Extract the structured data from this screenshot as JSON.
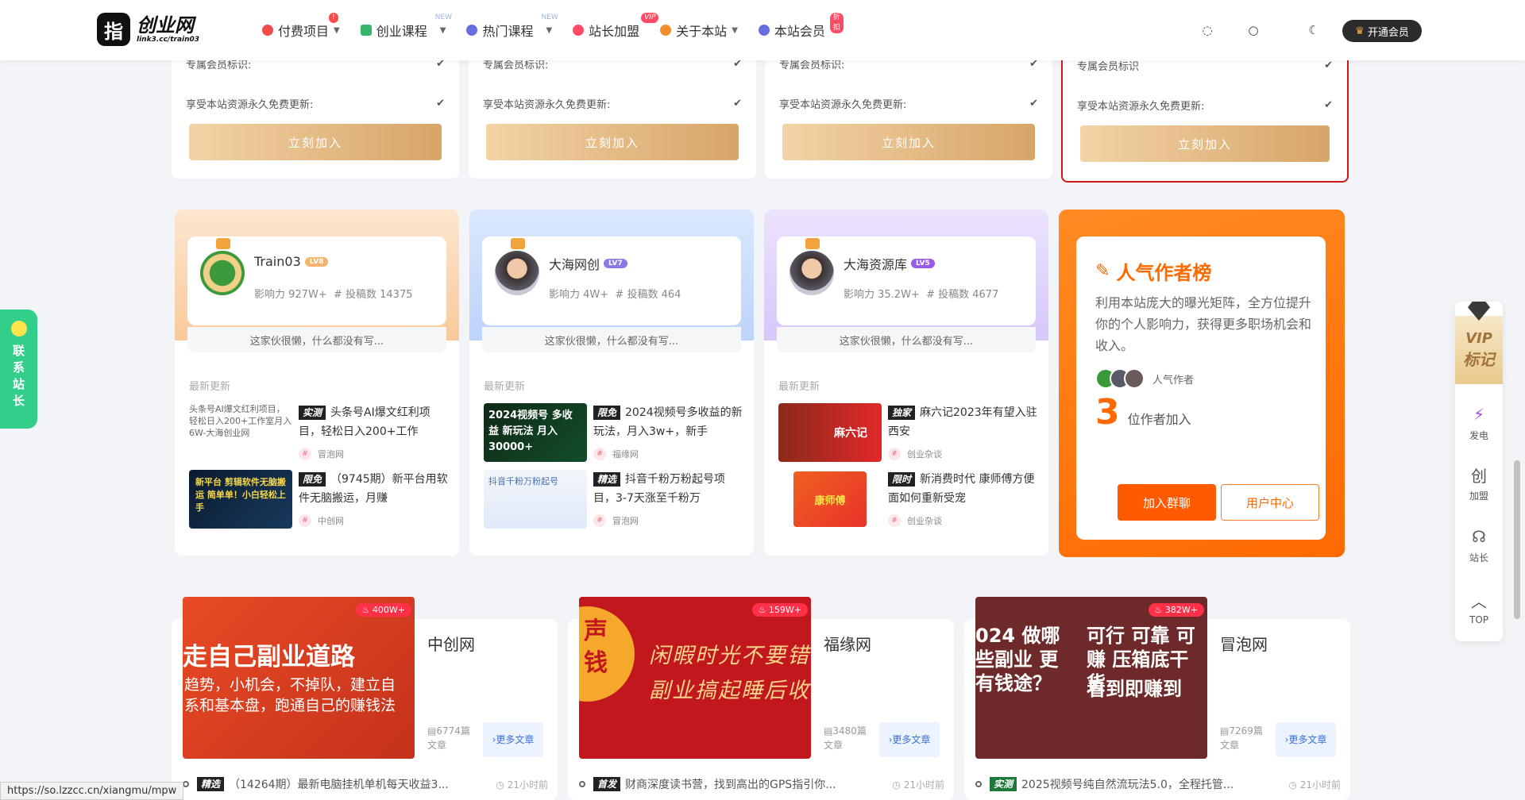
{
  "header": {
    "logo_mark": "指",
    "logo_name": "创业网",
    "logo_sub": "link3.cc/train03",
    "nav": [
      {
        "label": "付费项目",
        "badge": "",
        "icon_color": "#ef4b4b"
      },
      {
        "label": "创业课程",
        "badge": "NEW",
        "icon_color": "#35b56b"
      },
      {
        "label": "热门课程",
        "badge": "NEW",
        "icon_color": "#6a6fe0"
      },
      {
        "label": "站长加盟",
        "badge": "VIP",
        "icon_color": "#ff4b64"
      },
      {
        "label": "关于本站",
        "badge": "",
        "icon_color": "#f38c2a"
      },
      {
        "label": "本站会员",
        "badge": "折扣",
        "icon_color": "#6a6fe0"
      }
    ],
    "vip_button": "开通会员"
  },
  "plans": [
    {
      "row1": "专属会员标识:",
      "row2": "享受本站资源永久免费更新:",
      "button": "立刻加入"
    },
    {
      "row1": "专属会员标识:",
      "row2": "享受本站资源永久免费更新:",
      "button": "立刻加入"
    },
    {
      "row1": "专属会员标识:",
      "row2": "享受本站资源永久免费更新:",
      "button": "立刻加入"
    },
    {
      "row1": "专属会员标识",
      "row2": "享受本站资源永久免费更新:",
      "button": "立刻加入"
    }
  ],
  "authors": [
    {
      "name": "Train03",
      "level": "LV8",
      "influence": "影响力 927W+",
      "posts": "# 投稿数 14375",
      "bio": "这家伙很懒，什么都没有写...",
      "section": "最新更新",
      "items": [
        {
          "thumb_text": "头条号AI爆文红利项目，轻松日入200+工作室月入6W-大海创业网",
          "tag": "实测",
          "title": "头条号AI爆文红利项目，轻松日入200+工作",
          "src": "冒泡网"
        },
        {
          "thumb_text": "新平台 剪辑软件无脑搬运 简单单！小白轻松上手",
          "tag": "限免",
          "title": "（9745期）新平台用软件无脑搬运，月赚",
          "src": "中创网"
        }
      ]
    },
    {
      "name": "大海网创",
      "level": "LV7",
      "influence": "影响力 4W+",
      "posts": "# 投稿数 464",
      "bio": "这家伙很懒，什么都没有写...",
      "section": "最新更新",
      "items": [
        {
          "thumb_text": "2024视频号 多收益 新玩法 月入30000+",
          "tag": "限免",
          "title": "2024视频号多收益的新玩法，月入3w+，新手",
          "src": "福缘网"
        },
        {
          "thumb_text": "抖音千粉万粉起号",
          "tag": "精选",
          "title": "抖音千粉万粉起号项目，3-7天涨至千粉万",
          "src": "冒泡网"
        }
      ]
    },
    {
      "name": "大海资源库",
      "level": "LV5",
      "influence": "影响力 35.2W+",
      "posts": "# 投稿数 4677",
      "bio": "这家伙很懒，什么都没有写...",
      "section": "最新更新",
      "items": [
        {
          "thumb_text": "麻六记",
          "tag": "独家",
          "title": "麻六记2023年有望入驻西安",
          "src": "创业杂谈"
        },
        {
          "thumb_text": "康师傅",
          "tag": "限时",
          "title": "新消费时代 康师傅方便面如何重新受宠",
          "src": "创业杂谈"
        }
      ]
    }
  ],
  "popular": {
    "title": "人气作者榜",
    "desc": "利用本站庞大的曝光矩阵，全方位提升你的个人影响力，获得更多职场机会和收入。",
    "avatars_label": "人气作者",
    "count": "3",
    "count_label": "位作者加入",
    "btn_join": "加入群聊",
    "btn_user": "用户中心"
  },
  "topics": [
    {
      "img_line1": "走自己副业道路",
      "img_line2": "趋势，小机会，不掉队，建立自",
      "img_line3": "系和基本盘，跑通自己的赚钱法",
      "hot": "400W+",
      "name": "中创网",
      "count": "6774篇文章",
      "more": "更多文章",
      "tag": "精选",
      "post": "（14264期）最新电脑挂机单机每天收益3...",
      "time": "21小时前"
    },
    {
      "img_line1": "闲暇时光不要错",
      "img_line2": "副业搞起睡后收",
      "img_line3": "声 钱",
      "hot": "159W+",
      "name": "福缘网",
      "count": "3480篇文章",
      "more": "更多文章",
      "tag": "首发",
      "post": "财商深度读书营，找到高出的GPS指引你...",
      "time": "21小时前"
    },
    {
      "img_line1": "024 做哪些副业 更有钱途？",
      "img_line2": "可行 可靠 可赚 压箱底干货",
      "img_line3": "看到即赚到",
      "hot": "382W+",
      "name": "冒泡网",
      "count": "7269篇文章",
      "more": "更多文章",
      "tag": "实测",
      "post": "2025视频号纯自然流玩法5.0，全程托管...",
      "time": "21小时前"
    }
  ],
  "contact": {
    "label": "联系站长"
  },
  "right_bar": {
    "vip_line1": "VIP",
    "vip_line2": "标记",
    "items": [
      {
        "icon": "⚡",
        "label": "发电"
      },
      {
        "icon": "创",
        "label": "加盟"
      },
      {
        "icon": "☊",
        "label": "站长"
      },
      {
        "icon": "︿",
        "label": "TOP"
      }
    ]
  },
  "status_url": "https://so.lzzcc.cn/xiangmu/mpw",
  "colors": {
    "accent": "#ff6a00",
    "gold": "#d7a568",
    "green": "#32cf8b"
  }
}
